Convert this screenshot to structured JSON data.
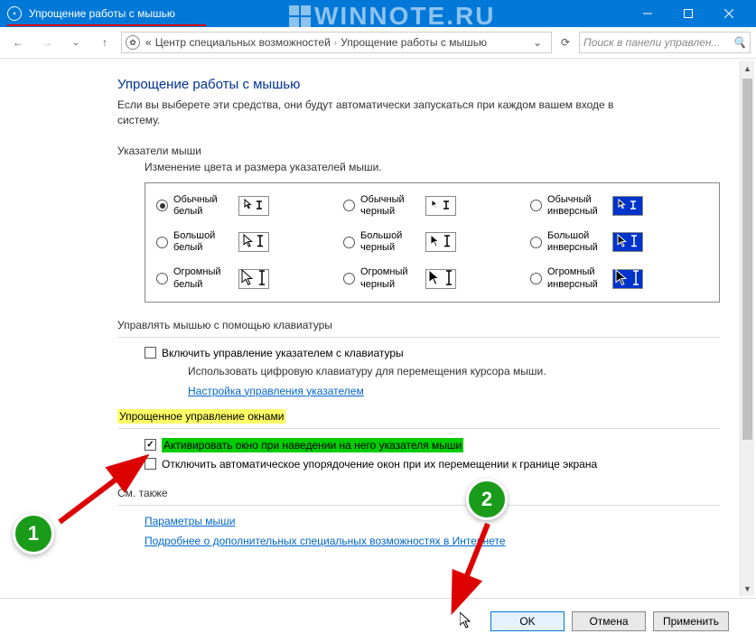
{
  "window": {
    "title": "Упрощение работы с мышью",
    "watermark": "WINNOTE.RU"
  },
  "nav": {
    "breadcrumb1": "Центр специальных возможностей",
    "breadcrumb2": "Упрощение работы с мышью",
    "search_placeholder": "Поиск в панели управлен..."
  },
  "page": {
    "heading": "Упрощение работы с мышью",
    "subheading": "Если вы выберете эти средства, они будут автоматически запускаться при каждом вашем входе в систему.",
    "pointers_section": "Указатели мыши",
    "pointers_sub": "Изменение цвета и размера указателей мыши.",
    "pointers": [
      {
        "label": "Обычный белый",
        "variant": "white",
        "selected": true
      },
      {
        "label": "Обычный черный",
        "variant": "black",
        "selected": false
      },
      {
        "label": "Обычный инверсный",
        "variant": "inv",
        "selected": false
      },
      {
        "label": "Большой белый",
        "variant": "white",
        "selected": false
      },
      {
        "label": "Большой черный",
        "variant": "black",
        "selected": false
      },
      {
        "label": "Большой инверсный",
        "variant": "inv",
        "selected": false
      },
      {
        "label": "Огромный белый",
        "variant": "white",
        "selected": false
      },
      {
        "label": "Огромный черный",
        "variant": "black",
        "selected": false
      },
      {
        "label": "Огромный инверсный",
        "variant": "inv",
        "selected": false
      }
    ],
    "keyboard_section": "Управлять мышью с помощью клавиатуры",
    "keyboard_chk": "Включить управление указателем с клавиатуры",
    "keyboard_desc": "Использовать цифровую клавиатуру для перемещения курсора мыши.",
    "keyboard_link": "Настройка управления указателем",
    "windows_section": "Упрощенное управление окнами",
    "windows_chk1": "Активировать окно при наведении на него указателя мыши",
    "windows_chk2": "Отключить автоматическое упорядочение окон при их перемещении к границе экрана",
    "also_section": "См. также",
    "also_link1": "Параметры мыши",
    "also_link2": "Подробнее о дополнительных специальных возможностях в Интернете"
  },
  "footer": {
    "ok": "OK",
    "cancel": "Отмена",
    "apply": "Применить"
  },
  "annotations": {
    "step1": "1",
    "step2": "2"
  }
}
